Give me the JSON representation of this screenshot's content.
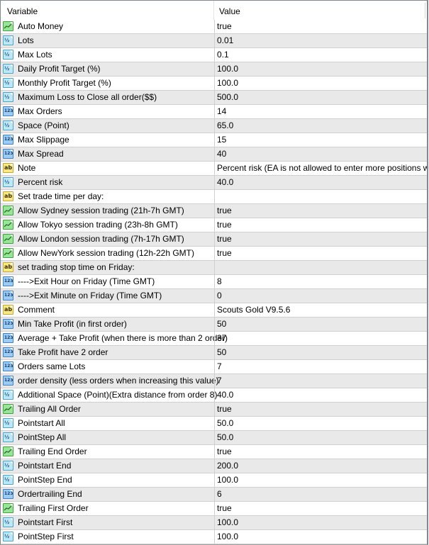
{
  "header": {
    "variable": "Variable",
    "value": "Value"
  },
  "icon_glyphs": {
    "bool": "",
    "double": "½",
    "int": "123",
    "string": "ab"
  },
  "rows": [
    {
      "type": "bool",
      "icon": "bool-chart-icon",
      "name": "Auto Money",
      "value": "true"
    },
    {
      "type": "double",
      "icon": "double-half-icon",
      "name": "Lots",
      "value": "0.01"
    },
    {
      "type": "double",
      "icon": "double-half-icon",
      "name": "Max Lots",
      "value": "0.1"
    },
    {
      "type": "double",
      "icon": "double-half-icon",
      "name": "Daily Profit Target (%)",
      "value": "100.0"
    },
    {
      "type": "double",
      "icon": "double-half-icon",
      "name": "Monthly Profit Target (%)",
      "value": "100.0"
    },
    {
      "type": "double",
      "icon": "double-half-icon",
      "name": "Maximum Loss to Close all order($$)",
      "value": "500.0"
    },
    {
      "type": "int",
      "icon": "integer-123-icon",
      "name": "Max Orders",
      "value": "14"
    },
    {
      "type": "double",
      "icon": "double-half-icon",
      "name": "Space (Point)",
      "value": "65.0"
    },
    {
      "type": "int",
      "icon": "integer-123-icon",
      "name": "Max Slippage",
      "value": "15"
    },
    {
      "type": "int",
      "icon": "integer-123-icon",
      "name": "Max Spread",
      "value": "40"
    },
    {
      "type": "string",
      "icon": "string-ab-icon",
      "name": "Note",
      "value": "Percent risk (EA is not allowed to enter more positions when..."
    },
    {
      "type": "double",
      "icon": "double-half-icon",
      "name": "Percent risk",
      "value": "40.0"
    },
    {
      "type": "string",
      "icon": "string-ab-icon",
      "name": "Set trade time per day:",
      "value": ""
    },
    {
      "type": "bool",
      "icon": "bool-chart-icon",
      "name": "Allow Sydney session trading (21h-7h GMT)",
      "value": "true"
    },
    {
      "type": "bool",
      "icon": "bool-chart-icon",
      "name": "Allow Tokyo session trading (23h-8h GMT)",
      "value": "true"
    },
    {
      "type": "bool",
      "icon": "bool-chart-icon",
      "name": "Allow London session trading (7h-17h GMT)",
      "value": "true"
    },
    {
      "type": "bool",
      "icon": "bool-chart-icon",
      "name": "Allow NewYork session trading (12h-22h GMT)",
      "value": "true"
    },
    {
      "type": "string",
      "icon": "string-ab-icon",
      "name": "set trading stop time on Friday:",
      "value": ""
    },
    {
      "type": "int",
      "icon": "integer-123-icon",
      "name": "---->Exit Hour on Friday (Time GMT)",
      "value": "8"
    },
    {
      "type": "int",
      "icon": "integer-123-icon",
      "name": "---->Exit Minute on Friday (Time GMT)",
      "value": "0"
    },
    {
      "type": "string",
      "icon": "string-ab-icon",
      "name": "Comment",
      "value": "Scouts Gold V9.5.6"
    },
    {
      "type": "int",
      "icon": "integer-123-icon",
      "name": "Min Take Profit (in first order)",
      "value": "50"
    },
    {
      "type": "int",
      "icon": "integer-123-icon",
      "name": "Average + Take Profit (when there is more than 2 order)",
      "value": "37"
    },
    {
      "type": "int",
      "icon": "integer-123-icon",
      "name": "Take Profit have 2 order",
      "value": "50"
    },
    {
      "type": "int",
      "icon": "integer-123-icon",
      "name": "Orders same Lots",
      "value": "7"
    },
    {
      "type": "int",
      "icon": "integer-123-icon",
      "name": "order density (less orders when increasing this value)",
      "value": "7"
    },
    {
      "type": "double",
      "icon": "double-half-icon",
      "name": "Additional Space (Point)(Extra distance from order 8)",
      "value": "40.0"
    },
    {
      "type": "bool",
      "icon": "bool-chart-icon",
      "name": "Trailing All Order",
      "value": "true"
    },
    {
      "type": "double",
      "icon": "double-half-icon",
      "name": "Pointstart All",
      "value": "50.0"
    },
    {
      "type": "double",
      "icon": "double-half-icon",
      "name": "PointStep All",
      "value": "50.0"
    },
    {
      "type": "bool",
      "icon": "bool-chart-icon",
      "name": "Trailing End Order",
      "value": "true"
    },
    {
      "type": "double",
      "icon": "double-half-icon",
      "name": "Pointstart End",
      "value": "200.0"
    },
    {
      "type": "double",
      "icon": "double-half-icon",
      "name": "PointStep End",
      "value": "100.0"
    },
    {
      "type": "int",
      "icon": "integer-123-icon",
      "name": "Ordertrailing End",
      "value": "6"
    },
    {
      "type": "bool",
      "icon": "bool-chart-icon",
      "name": "Trailing First Order",
      "value": "true"
    },
    {
      "type": "double",
      "icon": "double-half-icon",
      "name": "Pointstart First",
      "value": "100.0"
    },
    {
      "type": "double",
      "icon": "double-half-icon",
      "name": "PointStep First",
      "value": "100.0"
    }
  ]
}
